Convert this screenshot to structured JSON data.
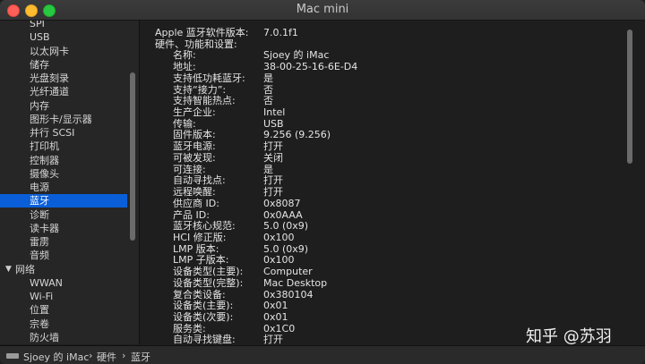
{
  "window": {
    "title": "Mac mini"
  },
  "sidebar": {
    "items": [
      {
        "label": "SPI"
      },
      {
        "label": "USB"
      },
      {
        "label": "以太网卡"
      },
      {
        "label": "储存"
      },
      {
        "label": "光盘刻录"
      },
      {
        "label": "光纤通道"
      },
      {
        "label": "内存"
      },
      {
        "label": "图形卡/显示器"
      },
      {
        "label": "并行 SCSI"
      },
      {
        "label": "打印机"
      },
      {
        "label": "控制器"
      },
      {
        "label": "摄像头"
      },
      {
        "label": "电源"
      },
      {
        "label": "蓝牙",
        "selected": true
      },
      {
        "label": "诊断"
      },
      {
        "label": "读卡器"
      },
      {
        "label": "雷雳"
      },
      {
        "label": "音频"
      },
      {
        "label": "网络",
        "group": true,
        "expanded": true
      },
      {
        "label": "WWAN"
      },
      {
        "label": "Wi-Fi"
      },
      {
        "label": "位置"
      },
      {
        "label": "宗卷"
      },
      {
        "label": "防火墙"
      }
    ]
  },
  "details": {
    "rows": [
      {
        "key": "Apple 蓝牙软件版本:",
        "value": "7.0.1f1",
        "level": 0
      },
      {
        "key": "硬件、功能和设置:",
        "value": "",
        "level": 0
      },
      {
        "key": "名称:",
        "value": "Sjoey 的 iMac",
        "level": 1
      },
      {
        "key": "地址:",
        "value": "38-00-25-16-6E-D4",
        "level": 1
      },
      {
        "key": "支持低功耗蓝牙:",
        "value": "是",
        "level": 1
      },
      {
        "key": "支持“接力”:",
        "value": "否",
        "level": 1
      },
      {
        "key": "支持智能热点:",
        "value": "否",
        "level": 1
      },
      {
        "key": "生产企业:",
        "value": "Intel",
        "level": 1
      },
      {
        "key": "传输:",
        "value": "USB",
        "level": 1
      },
      {
        "key": "固件版本:",
        "value": "9.256 (9.256)",
        "level": 1
      },
      {
        "key": "蓝牙电源:",
        "value": "打开",
        "level": 1
      },
      {
        "key": "可被发现:",
        "value": "关闭",
        "level": 1
      },
      {
        "key": "可连接:",
        "value": "是",
        "level": 1
      },
      {
        "key": "自动寻找点:",
        "value": "打开",
        "level": 1
      },
      {
        "key": "远程唤醒:",
        "value": "打开",
        "level": 1
      },
      {
        "key": "供应商 ID:",
        "value": "0x8087",
        "level": 1
      },
      {
        "key": "产品 ID:",
        "value": "0x0AAA",
        "level": 1
      },
      {
        "key": "蓝牙核心规范:",
        "value": "5.0 (0x9)",
        "level": 1
      },
      {
        "key": "HCI 修正版:",
        "value": "0x100",
        "level": 1
      },
      {
        "key": "LMP 版本:",
        "value": "5.0 (0x9)",
        "level": 1
      },
      {
        "key": "LMP 子版本:",
        "value": "0x100",
        "level": 1
      },
      {
        "key": "设备类型(主要):",
        "value": "Computer",
        "level": 1
      },
      {
        "key": "设备类型(完整):",
        "value": "Mac Desktop",
        "level": 1
      },
      {
        "key": "复合类设备:",
        "value": "0x380104",
        "level": 1
      },
      {
        "key": "设备类(主要):",
        "value": "0x01",
        "level": 1
      },
      {
        "key": "设备类(次要):",
        "value": "0x01",
        "level": 1
      },
      {
        "key": "服务类:",
        "value": "0x1C0",
        "level": 1
      },
      {
        "key": "自动寻找键盘:",
        "value": "打开",
        "level": 1
      }
    ]
  },
  "statusbar": {
    "breadcrumb": [
      "Sjoey 的 iMac",
      "硬件",
      "蓝牙"
    ],
    "separator": "›"
  },
  "watermark": "知乎 @苏羽"
}
